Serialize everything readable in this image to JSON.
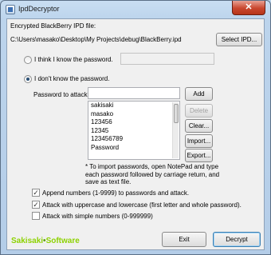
{
  "window": {
    "title": "IpdDecryptor",
    "close_glyph": "✕"
  },
  "file": {
    "label": "Encrypted BlackBerry IPD file:",
    "path": "C:\\Users\\masako\\Desktop\\My Projects\\debug\\BlackBerry.ipd",
    "select_button": "Select IPD..."
  },
  "mode": {
    "know_label": "I think I know the password.",
    "know_selected": false,
    "dont_know_label": "I don't know the password.",
    "dont_know_selected": true
  },
  "attack": {
    "label": "Password to attack:",
    "input_value": "",
    "add_button": "Add",
    "delete_button": "Delete",
    "clear_button": "Clear...",
    "import_button": "Import...",
    "export_button": "Export...",
    "passwords": [
      "sakisaki",
      "masako",
      "123456",
      "12345",
      "123456789",
      "Password"
    ],
    "note": "* To import passwords, open NotePad and type each password followed by carriage return, and save as text file."
  },
  "options": [
    {
      "label": "Append numbers (1-9999) to passwords and attack.",
      "checked": true
    },
    {
      "label": "Attack with uppercase and lowercase (first letter and whole password).",
      "checked": true
    },
    {
      "label": "Attack with simple numbers (0-999999)",
      "checked": false
    }
  ],
  "footer": {
    "logo_left": "Sakisaki",
    "logo_dot": "•",
    "logo_right": "Software",
    "exit_button": "Exit",
    "decrypt_button": "Decrypt"
  },
  "colors": {
    "logo_green": "#8dd200",
    "title_close_red": "#c9472e"
  }
}
